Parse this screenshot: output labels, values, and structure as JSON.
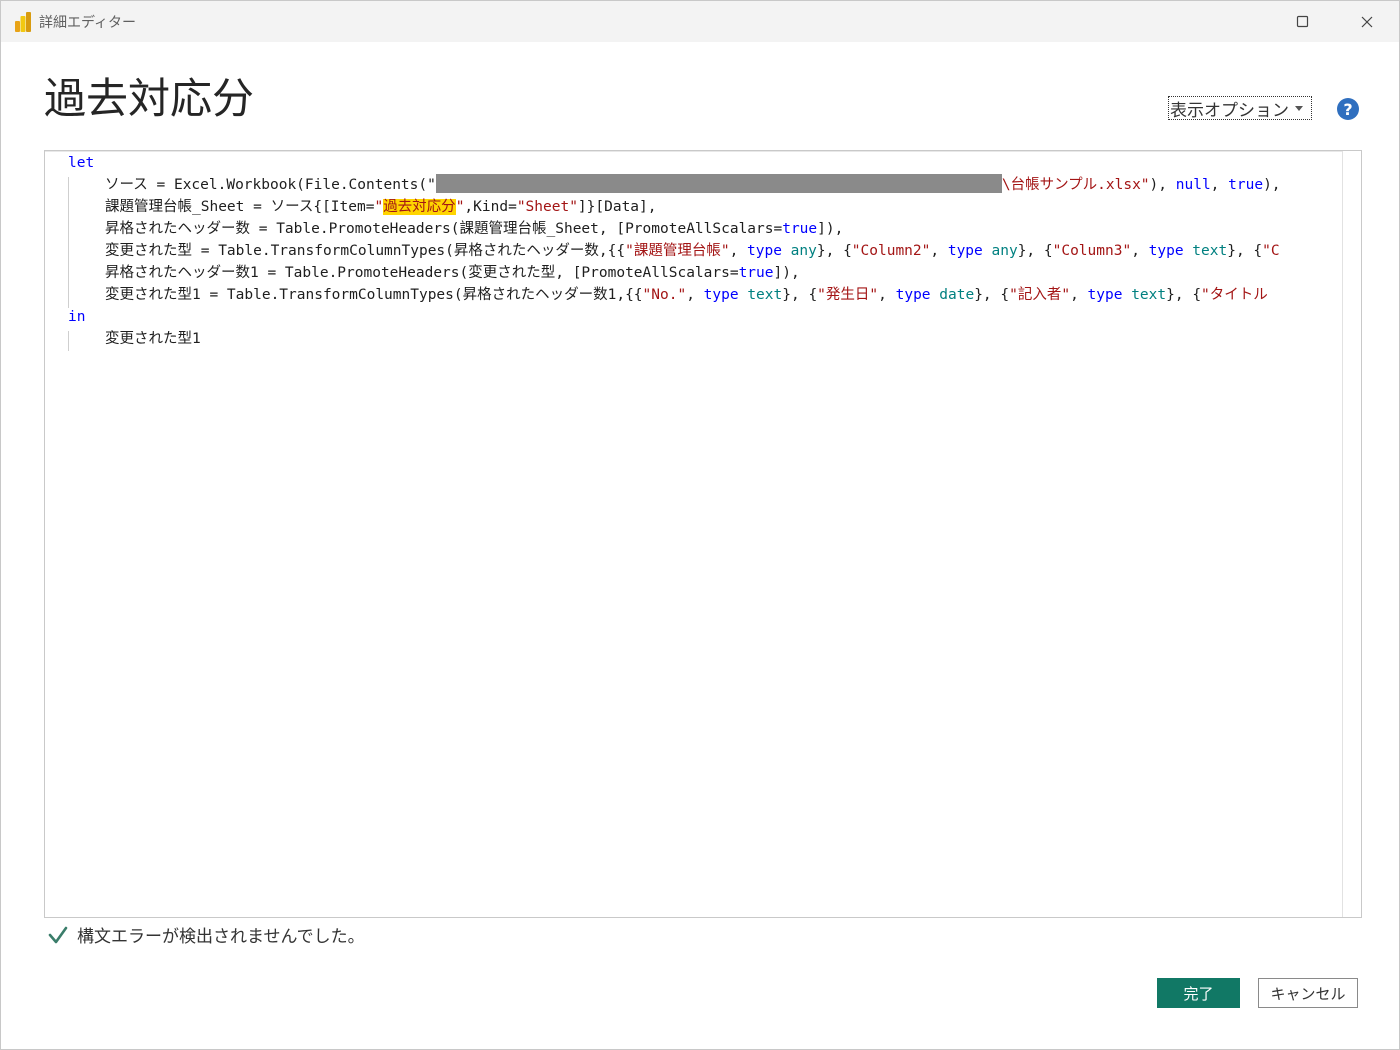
{
  "window": {
    "title": "詳細エディター"
  },
  "header": {
    "query_name": "過去対応分",
    "view_options_label": "表示オプション",
    "help_glyph": "?"
  },
  "code": {
    "lines": {
      "l1_let": "let",
      "l2_a": "ソース = Excel.Workbook(File.Contents(\"",
      "l2_b": "\\台帳サンプル.xlsx\"",
      "l2_c": "), ",
      "l2_null": "null",
      "l2_d": ", ",
      "l2_true": "true",
      "l2_e": "),",
      "l3_a": "課題管理台帳_Sheet = ソース{[Item=",
      "l3_q1": "\"",
      "l3_hl": "過去対応分",
      "l3_q2": "\"",
      "l3_b": ",Kind=",
      "l3_sheet": "\"Sheet\"",
      "l3_c": "]}[Data],",
      "l4_a": "昇格されたヘッダー数 = Table.PromoteHeaders(課題管理台帳_Sheet, [PromoteAllScalars=",
      "l4_true": "true",
      "l4_b": "]),",
      "l5_a": "変更された型 = Table.TransformColumnTypes(昇格されたヘッダー数,{{",
      "l5_s1": "\"課題管理台帳\"",
      "l5_b": ", ",
      "l5_type1": "type",
      "l5_any1": " any",
      "l5_c": "}, {",
      "l5_s2": "\"Column2\"",
      "l5_d": ", ",
      "l5_type2": "type",
      "l5_any2": " any",
      "l5_e": "}, {",
      "l5_s3": "\"Column3\"",
      "l5_f": ", ",
      "l5_type3": "type",
      "l5_text3": " text",
      "l5_g": "}, {",
      "l5_s4": "\"C",
      "l6_a": "昇格されたヘッダー数1 = Table.PromoteHeaders(変更された型, [PromoteAllScalars=",
      "l6_true": "true",
      "l6_b": "]),",
      "l7_a": "変更された型1 = Table.TransformColumnTypes(昇格されたヘッダー数1,{{",
      "l7_s1": "\"No.\"",
      "l7_b": ", ",
      "l7_type1": "type",
      "l7_text1": " text",
      "l7_c": "}, {",
      "l7_s2": "\"発生日\"",
      "l7_d": ", ",
      "l7_type2": "type",
      "l7_date2": " date",
      "l7_e": "}, {",
      "l7_s3": "\"記入者\"",
      "l7_f": ", ",
      "l7_type3": "type",
      "l7_text3": " text",
      "l7_g": "}, {",
      "l7_s4": "\"タイトル",
      "l8_in": "in",
      "l9": "変更された型1"
    }
  },
  "status": {
    "message": "構文エラーが検出されませんでした。"
  },
  "footer": {
    "done_label": "完了",
    "cancel_label": "キャンセル"
  },
  "colors": {
    "keyword": "#0000ff",
    "string": "#a31515",
    "type_name": "#008080",
    "highlight": "#ffd400",
    "primary_button": "#117865",
    "check": "#2e8b57"
  }
}
